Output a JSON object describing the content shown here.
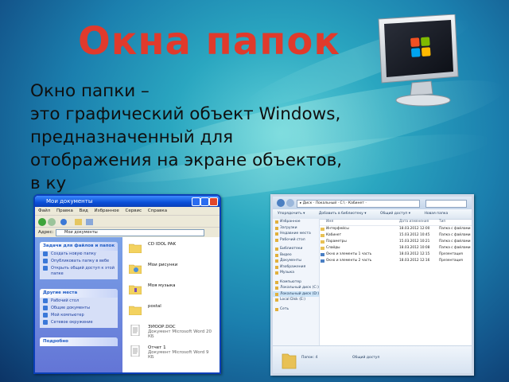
{
  "slide": {
    "title": "Окна папок",
    "text_lines": [
      "Окно папки –",
      "это графический объект Windows,",
      "предназначенный для",
      "отображения на экране объектов,",
      "в      ку"
    ]
  },
  "xp_window": {
    "title": "Мои документы",
    "menu": [
      "Файл",
      "Правка",
      "Вид",
      "Избранное",
      "Сервис",
      "Справка"
    ],
    "address_label": "Адрес:",
    "address_value": "Мои документы",
    "panels": [
      {
        "heading": "Задачи для файлов и папок",
        "items": [
          "Создать новую папку",
          "Опубликовать папку в вебе",
          "Открыть общий доступ к этой папке"
        ]
      },
      {
        "heading": "Другие места",
        "items": [
          "Рабочий стол",
          "Общие документы",
          "Мой компьютер",
          "Сетевое окружение"
        ]
      },
      {
        "heading": "Подробно",
        "items": []
      }
    ],
    "items": [
      {
        "name": "CD IDOL PAK",
        "kind": "folder"
      },
      {
        "name": "Мои рисунки",
        "kind": "folder"
      },
      {
        "name": "Моя музыка",
        "kind": "folder"
      },
      {
        "name": "postal",
        "kind": "folder"
      },
      {
        "name": "ЗУЮОР.DOC",
        "detail": "Документ Microsoft Word 20 КБ",
        "kind": "doc"
      },
      {
        "name": "Отчет 1",
        "detail": "Документ Microsoft Word 9 КБ",
        "kind": "doc"
      }
    ]
  },
  "win7_window": {
    "breadcrumb": "▸ Диск · Локальный · C:\\ · Кабинет ·",
    "commands": [
      "Упорядочить ▾",
      "Добавить в библиотеку ▾",
      "Общий доступ ▾",
      "Новая папка"
    ],
    "nav": [
      {
        "label": "Избранное",
        "sel": false,
        "gap": false
      },
      {
        "label": "Загрузки",
        "sel": false,
        "gap": false
      },
      {
        "label": "Недавние места",
        "sel": false,
        "gap": false
      },
      {
        "label": "Рабочий стол",
        "sel": false,
        "gap": false
      },
      {
        "label": "Библиотеки",
        "sel": false,
        "gap": true
      },
      {
        "label": "Видео",
        "sel": false,
        "gap": false
      },
      {
        "label": "Документы",
        "sel": false,
        "gap": false
      },
      {
        "label": "Изображения",
        "sel": false,
        "gap": false
      },
      {
        "label": "Музыка",
        "sel": false,
        "gap": false
      },
      {
        "label": "Компьютер",
        "sel": false,
        "gap": true
      },
      {
        "label": "Локальный диск (C:)",
        "sel": false,
        "gap": false
      },
      {
        "label": "Локальный диск (D:)",
        "sel": true,
        "gap": false
      },
      {
        "label": "Local Disk (E:)",
        "sel": false,
        "gap": false
      },
      {
        "label": "Сеть",
        "sel": false,
        "gap": true
      }
    ],
    "columns": [
      "Имя",
      "Дата изменения",
      "Тип"
    ],
    "rows": [
      {
        "name": "Интерфейсы",
        "date": "18.03.2012 12:00",
        "type": "Папка с файлами",
        "file": false
      },
      {
        "name": "Кабинет",
        "date": "15.03.2012 10:45",
        "type": "Папка с файлами",
        "file": false
      },
      {
        "name": "Параметры",
        "date": "15.03.2012 10:21",
        "type": "Папка с файлами",
        "file": false
      },
      {
        "name": "Слайды",
        "date": "18.03.2012 10:08",
        "type": "Папка с файлами",
        "file": false
      },
      {
        "name": "Окно и элементы 1 часть",
        "date": "18.03.2012 12:15",
        "type": "Презентация",
        "file": true
      },
      {
        "name": "Окно и элементы 2 часть",
        "date": "18.03.2012 12:16",
        "type": "Презентация",
        "file": true
      }
    ],
    "details_left": "Папок: 4",
    "details_right": "Общий доступ"
  }
}
